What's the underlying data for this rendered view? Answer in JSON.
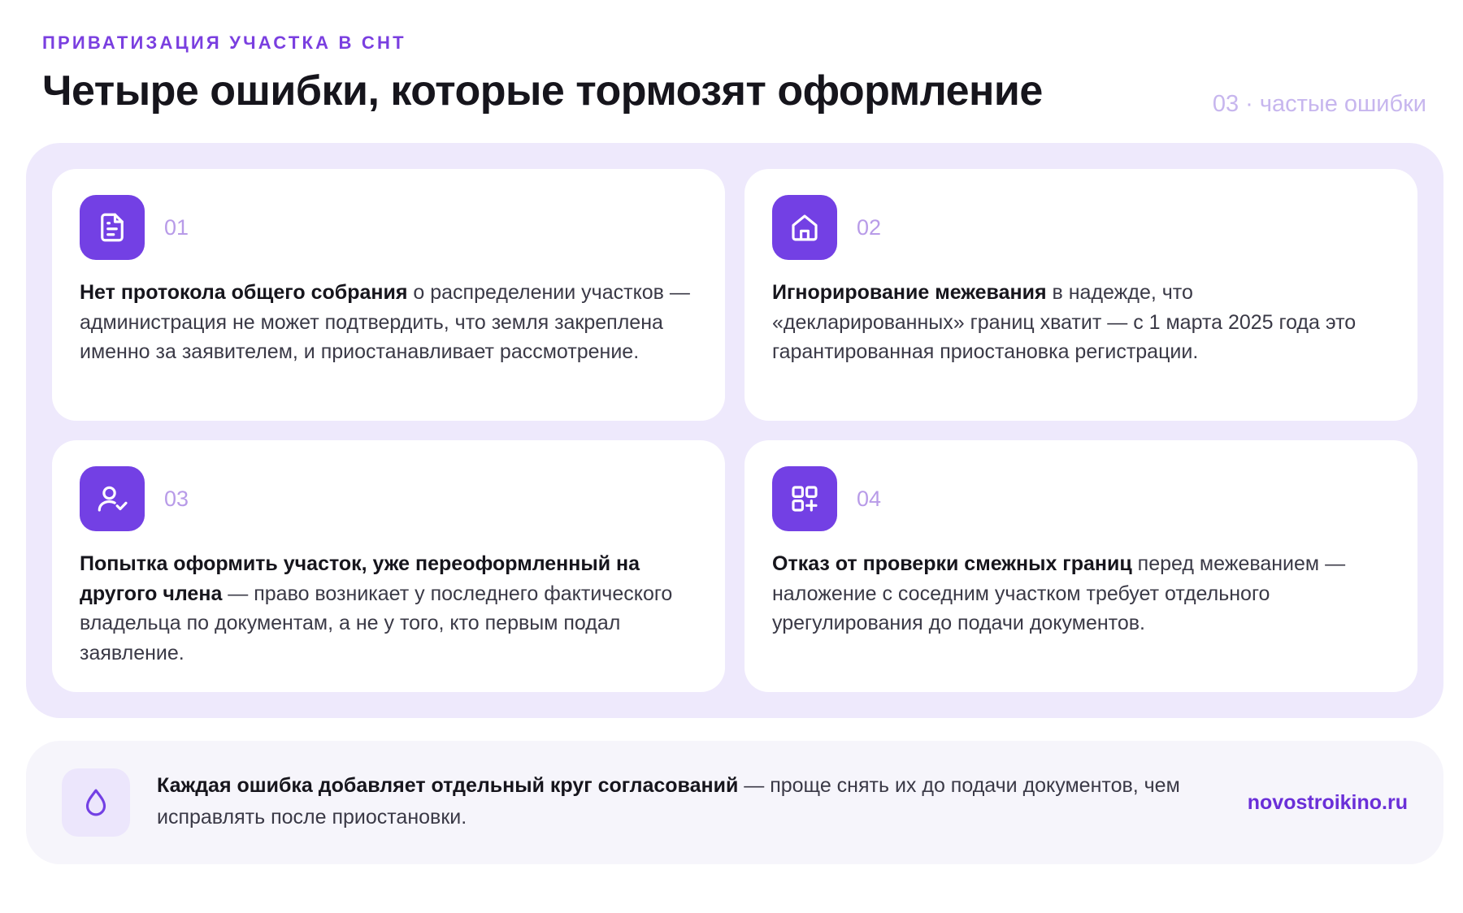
{
  "header": {
    "eyebrow": "ПРИВАТИЗАЦИЯ УЧАСТКА В СНТ",
    "title": "Четыре ошибки, которые тормозят оформление",
    "section_tag": "03 · частые ошибки"
  },
  "cards": [
    {
      "number": "01",
      "icon": "document-icon",
      "bold": "Нет протокола общего собрания",
      "text": " о распределении участков — администрация не может подтвердить, что земля закреплена именно за заявителем, и приостанавливает рассмотрение."
    },
    {
      "number": "02",
      "icon": "house-icon",
      "bold": "Игнорирование межевания",
      "text": " в надежде, что «декларированных» границ хватит — с 1 марта 2025 года это гарантированная приостановка регистрации."
    },
    {
      "number": "03",
      "icon": "user-check-icon",
      "bold": "Попытка оформить участок, уже переоформленный на другого члена",
      "text": " — право возникает у последнего фактического владельца по документам, а не у того, кто первым подал заявление."
    },
    {
      "number": "04",
      "icon": "grid-plus-icon",
      "bold": "Отказ от проверки смежных границ",
      "text": " перед межеванием — наложение с соседним участком требует отдельного урегулирования до подачи документов."
    }
  ],
  "footer": {
    "icon": "drop-icon",
    "bold": "Каждая ошибка добавляет отдельный круг согласований",
    "text": " — проще снять их до подачи документов, чем исправлять после приостановки.",
    "brand": "novostroikino.ru"
  },
  "colors": {
    "accent": "#7340e4",
    "panel_bg": "#eee9fc",
    "number": "#b89be8",
    "brand": "#6a2fd8"
  }
}
